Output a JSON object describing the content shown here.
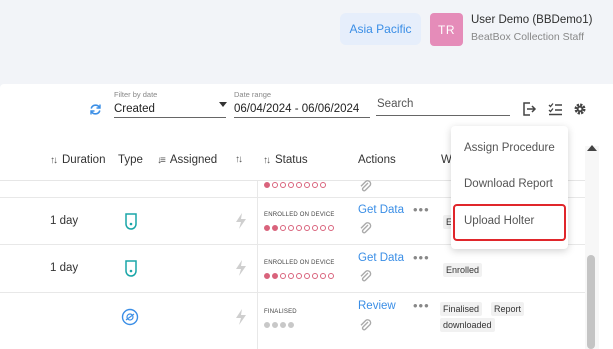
{
  "header": {
    "region": "Asia Pacific",
    "avatar_initials": "TR",
    "user_name": "User Demo (BBDemo1)",
    "user_role": "BeatBox Collection Staff"
  },
  "filters": {
    "filter_by_date_label": "Filter by date",
    "filter_by_date_value": "Created",
    "date_range_label": "Date range",
    "date_range_value": "06/04/2024 - 06/06/2024",
    "search_placeholder": "Search"
  },
  "toolbar": {
    "icons": [
      "refresh-icon",
      "export-icon",
      "checklist-icon",
      "gear-icon"
    ]
  },
  "columns": {
    "duration": "Duration",
    "type": "Type",
    "assigned": "Assigned",
    "status": "Status",
    "actions": "Actions",
    "w_partial": "W"
  },
  "rows": [
    {
      "duration": "",
      "status": "",
      "action": "",
      "badges": []
    },
    {
      "duration": "1 day",
      "status": "ENROLLED ON DEVICE",
      "action": "Get Data",
      "badges": [
        "En"
      ]
    },
    {
      "duration": "1 day",
      "status": "ENROLLED ON DEVICE",
      "action": "Get Data",
      "badges": [
        "Enrolled"
      ]
    },
    {
      "duration": "",
      "status": "FINALISED",
      "action": "Review",
      "badges": [
        "Finalised",
        "Report",
        "downloaded"
      ]
    }
  ],
  "menu": {
    "items": [
      "Assign Procedure",
      "Download Report",
      "Upload Holter"
    ],
    "highlighted": "Upload Holter",
    "highlight_color": "#e0262b"
  },
  "colors": {
    "accent": "#3a8ee6",
    "status_dot": "#d9637c",
    "avatar": "#e58cb9"
  }
}
